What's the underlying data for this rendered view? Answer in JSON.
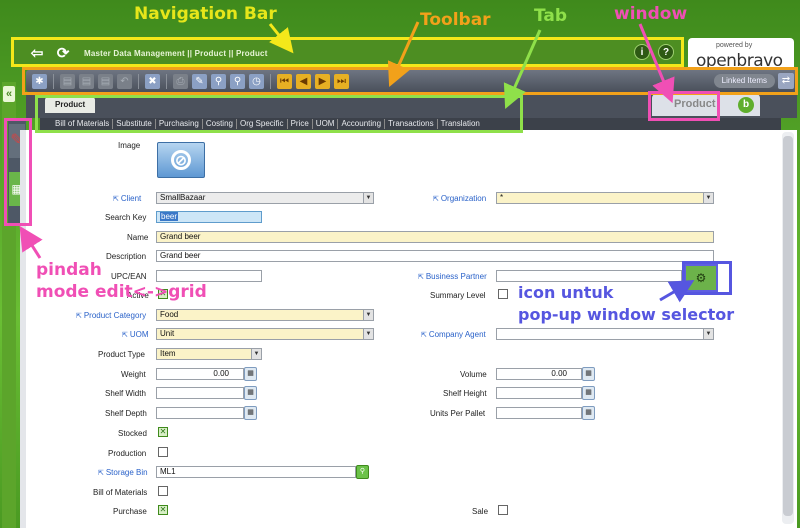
{
  "annotations": {
    "navigation_bar": "Navigation Bar",
    "toolbar": "Toolbar",
    "tab": "Tab",
    "window": "window",
    "mode_line1": "pindah",
    "mode_line2": "mode edit<->grid",
    "popup_line1": "icon untuk",
    "popup_line2": "pop-up window selector"
  },
  "navbar": {
    "breadcrumb": "Master Data Management || Product  ||  Product",
    "back_icon": "back-arrow-icon",
    "refresh_icon": "refresh-icon",
    "info_label": "i",
    "help_label": "?"
  },
  "logo": {
    "powered": "powered by",
    "brand": "openbravo"
  },
  "toolbar": {
    "linked_items": "Linked Items"
  },
  "window": {
    "title": "Product",
    "active_tab": "Product"
  },
  "subtabs": [
    "Bill of Materials",
    "Substitute",
    "Purchasing",
    "Costing",
    "Org Specific",
    "Price",
    "UOM",
    "Accounting",
    "Transactions",
    "Translation"
  ],
  "form": {
    "image": "Image",
    "client_label": "Client",
    "client_value": "SmallBazaar",
    "org_label": "Organization",
    "org_value": "*",
    "search_key_label": "Search Key",
    "search_key_value": "beer",
    "name_label": "Name",
    "name_value": "Grand beer",
    "description_label": "Description",
    "description_value": "Grand beer",
    "upc_label": "UPC/EAN",
    "upc_value": "",
    "bp_label": "Business Partner",
    "bp_value": "",
    "active_label": "Active",
    "summary_label": "Summary Level",
    "category_label": "Product Category",
    "category_value": "Food",
    "uom_label": "UOM",
    "uom_value": "Unit",
    "company_agent_label": "Company Agent",
    "company_agent_value": "",
    "product_type_label": "Product Type",
    "product_type_value": "Item",
    "weight_label": "Weight",
    "weight_value": "0.00",
    "volume_label": "Volume",
    "volume_value": "0.00",
    "shelf_width_label": "Shelf Width",
    "shelf_width_value": "",
    "shelf_height_label": "Shelf Height",
    "shelf_height_value": "",
    "shelf_depth_label": "Shelf Depth",
    "shelf_depth_value": "",
    "units_pallet_label": "Units Per Pallet",
    "units_pallet_value": "",
    "stocked_label": "Stocked",
    "production_label": "Production",
    "storage_bin_label": "Storage Bin",
    "storage_bin_value": "ML1",
    "bom_label": "Bill of Materials",
    "purchase_label": "Purchase",
    "sale_label": "Sale"
  }
}
